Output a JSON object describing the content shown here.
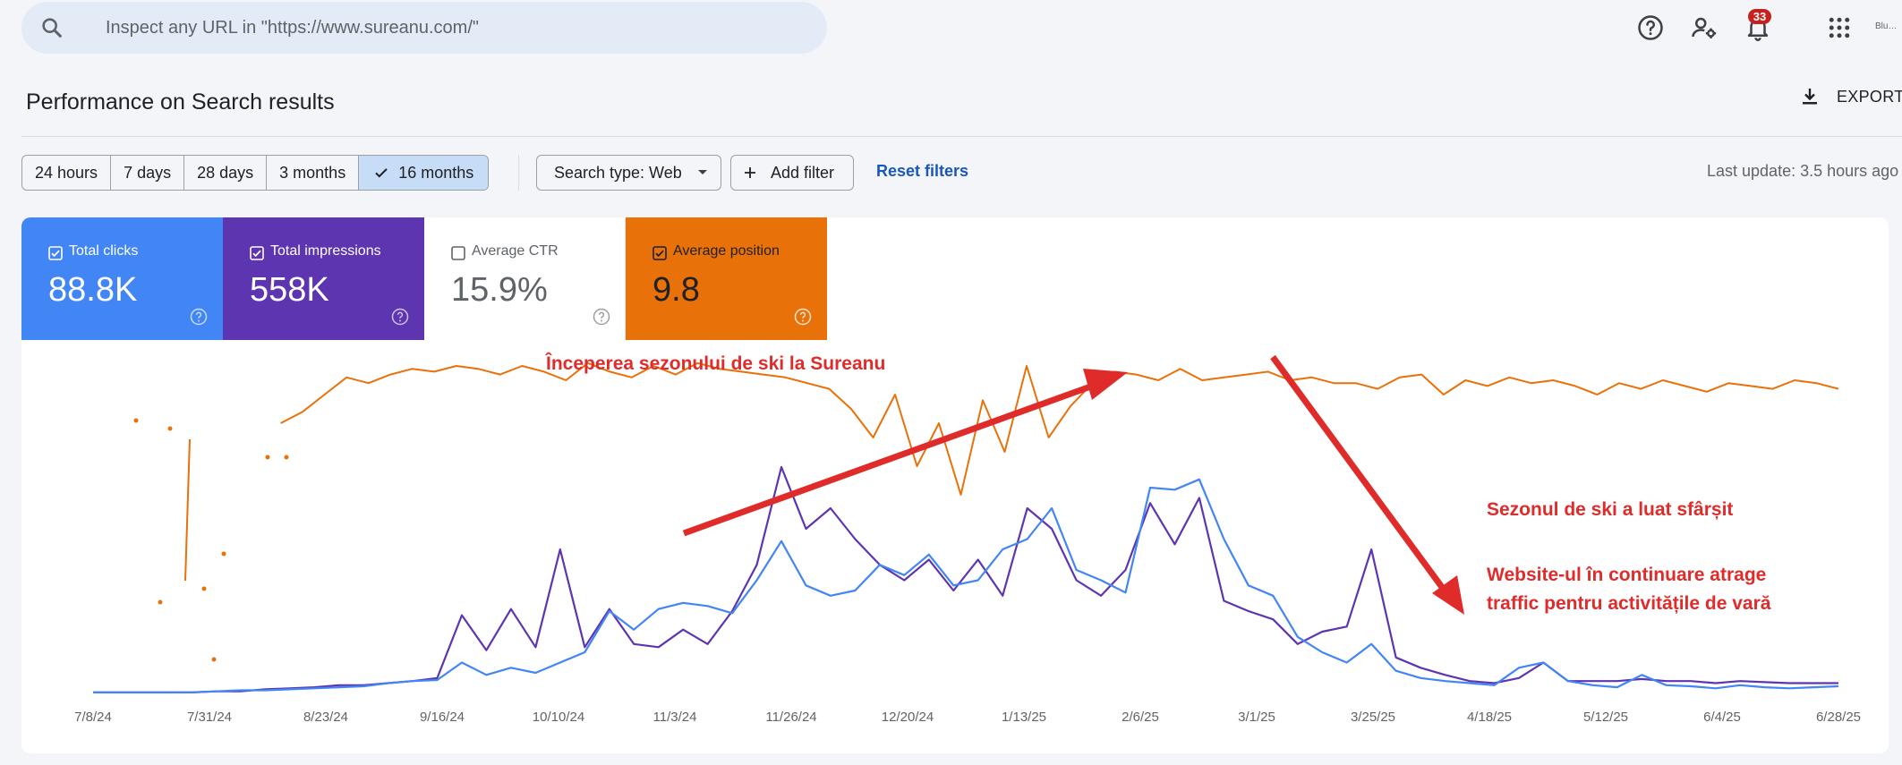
{
  "search": {
    "placeholder": "Inspect any URL in \"https://www.sureanu.com/\""
  },
  "header": {
    "notifications_count": "33",
    "logo_text": "Blu…"
  },
  "page": {
    "title": "Performance on Search results",
    "export_label": "EXPORT"
  },
  "filters": {
    "ranges": [
      {
        "label": "24 hours",
        "active": false
      },
      {
        "label": "7 days",
        "active": false
      },
      {
        "label": "28 days",
        "active": false
      },
      {
        "label": "3 months",
        "active": false
      },
      {
        "label": "16 months",
        "active": true
      }
    ],
    "search_type": "Search type: Web",
    "add_filter": "Add filter",
    "reset": "Reset filters",
    "last_update": "Last update: 3.5 hours ago"
  },
  "metrics": [
    {
      "label": "Total clicks",
      "value": "88.8K",
      "checked": true,
      "color": "#4285f4"
    },
    {
      "label": "Total impressions",
      "value": "558K",
      "checked": true,
      "color": "#5e35b1"
    },
    {
      "label": "Average CTR",
      "value": "15.9%",
      "checked": false,
      "color": "#ffffff"
    },
    {
      "label": "Average position",
      "value": "9.8",
      "checked": true,
      "color": "#e8710a"
    }
  ],
  "annotations": {
    "start": "Începerea sezonului de ski la Sureanu",
    "end": "Sezonul de ski a luat sfârșit",
    "summer_line1": "Website-ul în continuare atrage",
    "summer_line2": "traffic pentru activitățile de vară"
  },
  "chart_data": {
    "type": "line",
    "x_ticks": [
      "7/8/24",
      "7/31/24",
      "8/23/24",
      "9/16/24",
      "10/10/24",
      "11/3/24",
      "11/26/24",
      "12/20/24",
      "1/13/25",
      "2/6/25",
      "3/1/25",
      "3/25/25",
      "4/18/25",
      "5/12/25",
      "6/4/25",
      "6/28/25"
    ],
    "series": [
      {
        "name": "Total clicks",
        "color": "#4285f4",
        "values": [
          1,
          1,
          1,
          1,
          1,
          2,
          3,
          3,
          4,
          5,
          6,
          7,
          10,
          12,
          13,
          30,
          18,
          25,
          20,
          30,
          40,
          80,
          62,
          82,
          88,
          85,
          78,
          110,
          148,
          105,
          95,
          100,
          125,
          115,
          135,
          105,
          110,
          140,
          150,
          180,
          120,
          110,
          98,
          200,
          198,
          208,
          150,
          105,
          95,
          55,
          40,
          30,
          48,
          22,
          15,
          12,
          10,
          8,
          25,
          30,
          12,
          8,
          6,
          18,
          8,
          7,
          5,
          8,
          6,
          5,
          6,
          7
        ]
      },
      {
        "name": "Total impressions",
        "color": "#5e35b1",
        "values": [
          1,
          1,
          1,
          1,
          1,
          2,
          2,
          4,
          5,
          6,
          8,
          8,
          10,
          12,
          15,
          76,
          42,
          82,
          45,
          140,
          45,
          82,
          48,
          45,
          62,
          48,
          80,
          125,
          220,
          160,
          180,
          150,
          125,
          110,
          130,
          100,
          130,
          95,
          180,
          160,
          110,
          95,
          120,
          185,
          145,
          190,
          90,
          80,
          72,
          48,
          60,
          65,
          140,
          35,
          25,
          18,
          12,
          10,
          15,
          30,
          12,
          12,
          12,
          14,
          12,
          12,
          10,
          12,
          11,
          10,
          10,
          10
        ]
      },
      {
        "name": "Average position",
        "color": "#e8710a",
        "values": [
          9,
          8.6,
          8,
          7.4,
          7.6,
          7.3,
          7.1,
          7.2,
          7,
          7.1,
          7.3,
          7,
          7.2,
          7.5,
          6.9,
          7.2,
          7.4,
          7,
          7.3,
          6.9,
          7.1,
          7.2,
          7.3,
          7.4,
          7.6,
          7.8,
          8.5,
          9.5,
          8,
          10.5,
          9,
          11.5,
          8.2,
          10,
          7,
          9.5,
          8.4,
          7.6,
          7.2,
          7.3,
          7.5,
          7.1,
          7.5,
          7.4,
          7.3,
          7.2,
          7.5,
          7.4,
          7.6,
          7.6,
          7.8,
          7.4,
          7.3,
          8,
          7.5,
          7.7,
          7.4,
          7.6,
          7.5,
          7.7,
          8,
          7.6,
          7.8,
          7.5,
          7.7,
          7.9,
          7.6,
          7.7,
          7.8,
          7.5,
          7.6,
          7.8
        ]
      }
    ]
  }
}
